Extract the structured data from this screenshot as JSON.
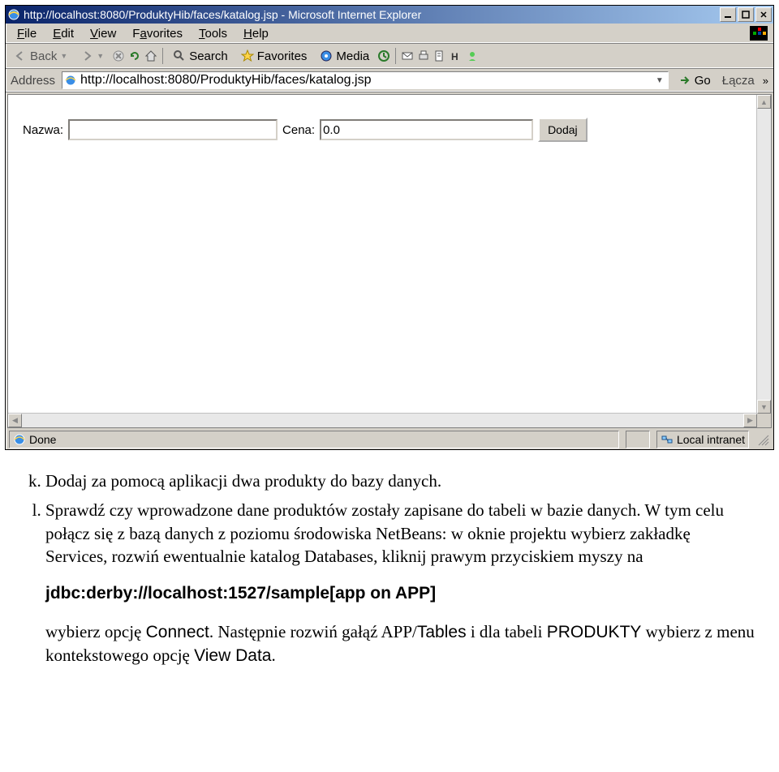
{
  "window": {
    "title": "http://localhost:8080/ProduktyHib/faces/katalog.jsp - Microsoft Internet Explorer"
  },
  "menubar": {
    "items": [
      {
        "label": "File",
        "u": "F"
      },
      {
        "label": "Edit",
        "u": "E"
      },
      {
        "label": "View",
        "u": "V"
      },
      {
        "label": "Favorites",
        "u": "a"
      },
      {
        "label": "Tools",
        "u": "T"
      },
      {
        "label": "Help",
        "u": "H"
      }
    ]
  },
  "toolbar": {
    "back": "Back",
    "search": "Search",
    "favorites": "Favorites",
    "media": "Media"
  },
  "addressbar": {
    "label": "Address",
    "url": "http://localhost:8080/ProduktyHib/faces/katalog.jsp",
    "go": "Go",
    "links": "Łącza"
  },
  "page_form": {
    "nazwa_label": "Nazwa:",
    "nazwa_value": "",
    "cena_label": "Cena:",
    "cena_value": "0.0",
    "submit_label": "Dodaj"
  },
  "statusbar": {
    "status": "Done",
    "zone": "Local intranet"
  },
  "doc": {
    "item_k": "Dodaj za pomocą aplikacji dwa produkty do bazy danych.",
    "item_l_1": "Sprawdź czy wprowadzone dane produktów zostały zapisane do tabeli w bazie danych. W tym celu połącz się z bazą danych z poziomu środowiska NetBeans: w oknie projektu wybierz zakładkę Services, rozwiń ewentualnie katalog Databases, kliknij prawym przyciskiem myszy na",
    "jdbc": "jdbc:derby://localhost:1527/sample[app on APP]",
    "item_l_2a": "wybierz opcję ",
    "connect": "Connect",
    "item_l_2b": ". Następnie rozwiń gałąź APP/",
    "tables": "Tables",
    "item_l_2c": " i dla tabeli ",
    "produkty": "PRODUKTY",
    "item_l_2d": " wybierz z menu kontekstowego opcję ",
    "viewdata": "View Data",
    "item_l_2e": "."
  }
}
